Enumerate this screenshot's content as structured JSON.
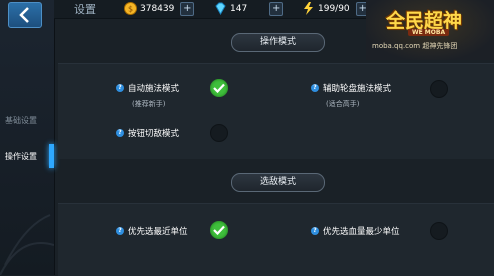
{
  "header": {
    "title": "设置",
    "gold": "378439",
    "diamonds": "147",
    "energy": "199/90"
  },
  "logo": {
    "main": "全民超神",
    "sub": "WE MOBA",
    "url": "moba.qq.com 超神先锋团"
  },
  "sidebar": {
    "items": [
      {
        "label": "基础设置",
        "active": false
      },
      {
        "label": "操作设置",
        "active": true
      }
    ]
  },
  "sections": {
    "operation_mode": {
      "header": "操作模式",
      "options": [
        {
          "label": "自动施法模式",
          "hint": "(推荐新手)",
          "checked": true
        },
        {
          "label": "辅助轮盘施法模式",
          "hint": "(适合高手)",
          "checked": false
        },
        {
          "label": "按钮切敌模式",
          "hint": "",
          "checked": false
        }
      ]
    },
    "target_mode": {
      "header": "选敌模式",
      "options": [
        {
          "label": "优先选最近单位",
          "checked": true
        },
        {
          "label": "优先选血量最少单位",
          "checked": false
        }
      ]
    }
  },
  "colors": {
    "accent": "#2ea8ff",
    "check_on": "#3fbf3c",
    "background": "#1a2127"
  }
}
